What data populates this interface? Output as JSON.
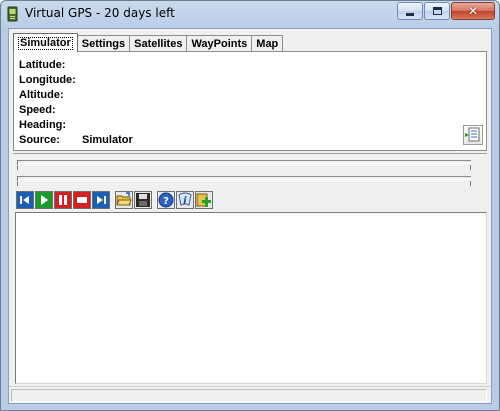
{
  "window": {
    "title": "Virtual GPS - 20 days left"
  },
  "tabs": [
    {
      "label": "Simulator",
      "active": true
    },
    {
      "label": "Settings",
      "active": false
    },
    {
      "label": "Satellites",
      "active": false
    },
    {
      "label": "WayPoints",
      "active": false
    },
    {
      "label": "Map",
      "active": false
    }
  ],
  "info": {
    "latitude_label": "Latitude:",
    "longitude_label": "Longitude:",
    "altitude_label": "Altitude:",
    "speed_label": "Speed:",
    "heading_label": "Heading:",
    "source_label": "Source:",
    "source_value": "Simulator"
  },
  "toolbar": {
    "icons": [
      "skip-back-icon",
      "play-icon",
      "pause-icon",
      "stop-icon",
      "skip-forward-icon",
      "open-folder-icon",
      "save-disk-icon",
      "help-icon",
      "info-icon",
      "add-icon"
    ]
  },
  "colors": {
    "tab_active_bg": "#ffffff",
    "client_bg": "#f0f0f0",
    "titlebar": "#b7cce6",
    "play_green": "#1e9a2c",
    "pause_red": "#d42020",
    "nav_blue": "#1a5fb4"
  }
}
